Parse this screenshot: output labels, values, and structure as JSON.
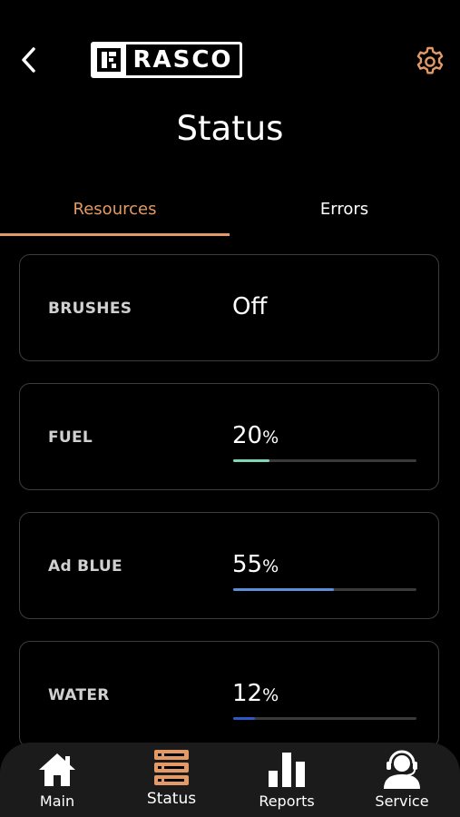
{
  "header": {
    "back_icon": "chevron-left-icon",
    "logo_text": "RASCO",
    "settings_icon": "gear-icon",
    "accent_color": "#e39a66"
  },
  "page": {
    "title": "Status"
  },
  "tabs": [
    {
      "label": "Resources",
      "active": true
    },
    {
      "label": "Errors",
      "active": false
    }
  ],
  "resources": [
    {
      "label": "BRUSHES",
      "value": "Off"
    },
    {
      "label": "FUEL",
      "value": "20",
      "unit": "%",
      "progress": 0.2,
      "bar_color": "#7fd6b4"
    },
    {
      "label": "Ad BLUE",
      "value": "55",
      "unit": "%",
      "progress": 0.55,
      "bar_color": "#5b8fd9"
    },
    {
      "label": "WATER",
      "value": "12",
      "unit": "%",
      "progress": 0.12,
      "bar_color": "#2e57c7"
    }
  ],
  "nav": [
    {
      "label": "Main",
      "icon": "home-icon"
    },
    {
      "label": "Status",
      "icon": "status-icon",
      "active": true
    },
    {
      "label": "Reports",
      "icon": "bar-chart-icon"
    },
    {
      "label": "Service",
      "icon": "support-agent-icon"
    }
  ]
}
